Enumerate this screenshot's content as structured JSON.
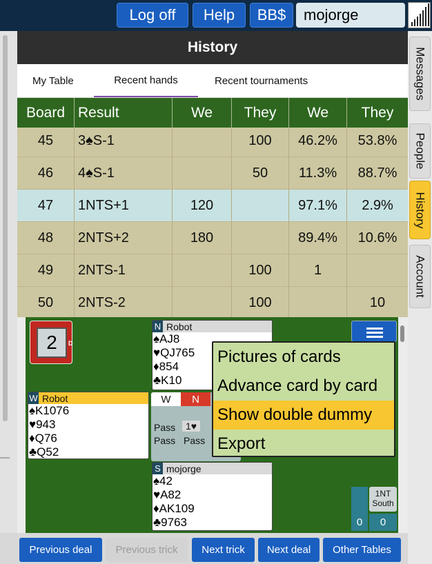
{
  "topbar": {
    "logoff": "Log off",
    "help": "Help",
    "bbdollars": "BB$",
    "username": "mojorge"
  },
  "history": {
    "title": "History",
    "tabs": [
      {
        "label": "My Table"
      },
      {
        "label": "Recent hands",
        "active": true
      },
      {
        "label": "Recent tournaments"
      }
    ],
    "columns": [
      "Board",
      "Result",
      "We",
      "They",
      "We",
      "They"
    ],
    "rows": [
      {
        "board": "45",
        "result": "3♠S-1",
        "we": "",
        "they": "100",
        "we_pct": "46.2%",
        "they_pct": "53.8%"
      },
      {
        "board": "46",
        "result": "4♠S-1",
        "we": "",
        "they": "50",
        "we_pct": "11.3%",
        "they_pct": "88.7%"
      },
      {
        "board": "47",
        "result": "1NTS+1",
        "we": "120",
        "they": "",
        "we_pct": "97.1%",
        "they_pct": "2.9%",
        "highlight": true
      },
      {
        "board": "48",
        "result": "2NTS+2",
        "we": "180",
        "they": "",
        "we_pct": "89.4%",
        "they_pct": "10.6%"
      },
      {
        "board": "49",
        "result": "2NTS-1",
        "we": "",
        "they": "100",
        "we_pct": "1",
        "they_pct": ""
      },
      {
        "board": "50",
        "result": "2NTS-2",
        "we": "",
        "they": "100",
        "we_pct": "",
        "they_pct": "10"
      }
    ]
  },
  "side_tabs": [
    {
      "label": "Messages"
    },
    {
      "label": "People"
    },
    {
      "label": "History",
      "active": true
    },
    {
      "label": "Account"
    }
  ],
  "board": {
    "number": "2",
    "dealer_label": "D"
  },
  "north": {
    "dir": "N",
    "name": "Robot",
    "spades": "♠AJ8",
    "hearts": "♥QJ765",
    "diamonds": "♦854",
    "clubs": "♣K10"
  },
  "west": {
    "dir": "W",
    "name": "Robot",
    "spades": "♠K1076",
    "hearts": "♥943",
    "diamonds": "♦Q76",
    "clubs": "♣Q52"
  },
  "south": {
    "dir": "S",
    "name": "mojorge",
    "spades": "♠42",
    "hearts": "♥A82",
    "diamonds": "♦AK109",
    "clubs": "♣9763"
  },
  "auction": {
    "col_w": "W",
    "col_n": "N",
    "bids": [
      "Pass",
      "1♥",
      "Pass",
      "Pass"
    ]
  },
  "menu": {
    "items": [
      "Pictures of cards",
      "Advance card by card",
      "Show double dummy",
      "Export"
    ],
    "selected_index": 2
  },
  "contract": {
    "line1": "1NT",
    "line2": "South"
  },
  "tricks": {
    "ns": "0",
    "ew": "0"
  },
  "bottom": {
    "previous_deal": "Previous deal",
    "previous_trick": "Previous trick",
    "next_trick": "Next trick",
    "next_deal": "Next deal",
    "other_tables": "Other Tables"
  },
  "colors": {
    "felt": "#2b6a1c",
    "header_green": "#2e661f",
    "accent_blue": "#1a5fc0",
    "highlight_yellow": "#f7c630",
    "menu_green": "#c7dda0"
  }
}
